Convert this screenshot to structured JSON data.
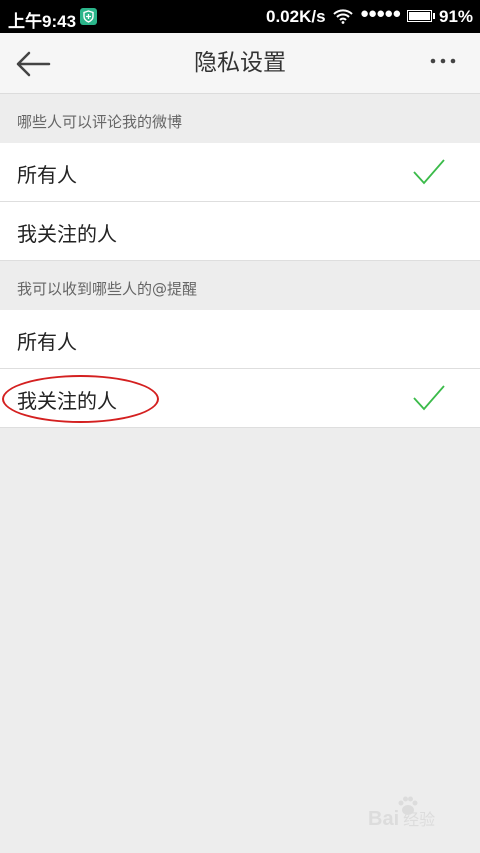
{
  "status_bar": {
    "time": "上午9:43",
    "network_speed": "0.02K/s",
    "signal_dots": "●●●●●",
    "battery": "91%"
  },
  "nav": {
    "title": "隐私设置",
    "more_icon": "more-dots-icon",
    "back_icon": "back-arrow-icon"
  },
  "sections": [
    {
      "header": "哪些人可以评论我的微博",
      "options": [
        {
          "label": "所有人",
          "selected": true
        },
        {
          "label": "我关注的人",
          "selected": false
        }
      ]
    },
    {
      "header": "我可以收到哪些人的@提醒",
      "options": [
        {
          "label": "所有人",
          "selected": false
        },
        {
          "label": "我关注的人",
          "selected": true
        }
      ]
    }
  ],
  "colors": {
    "check": "#3bbb4a",
    "annotation": "#d42020",
    "background": "#ededed"
  },
  "watermark": {
    "latin": "Bai",
    "chinese": "经验"
  }
}
